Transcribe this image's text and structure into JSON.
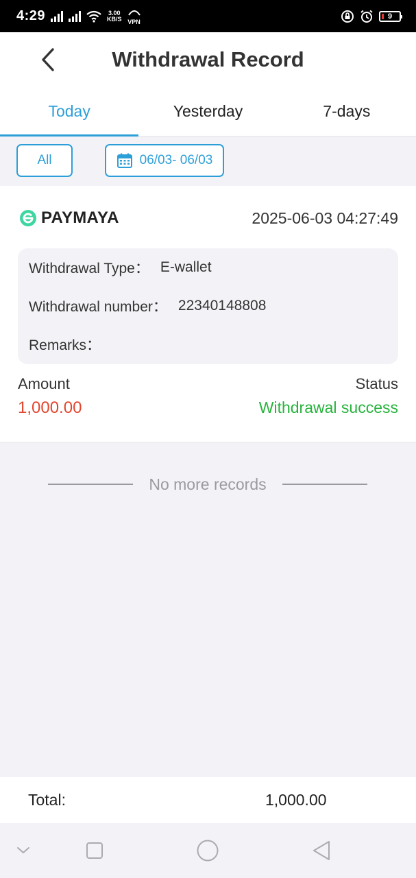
{
  "status_bar": {
    "time": "4:29",
    "net_speed_value": "3.00",
    "net_speed_unit": "KB/S",
    "vpn": "VPN",
    "battery": "9",
    "battery_color": "#e53935"
  },
  "header": {
    "title": "Withdrawal Record",
    "back_icon": "chevron-left-icon"
  },
  "tabs": [
    {
      "label": "Today",
      "active": true
    },
    {
      "label": "Yesterday",
      "active": false
    },
    {
      "label": "7-days",
      "active": false
    }
  ],
  "filters": {
    "all_label": "All",
    "date_range": "06/03- 06/03",
    "date_icon": "calendar-icon"
  },
  "record": {
    "brand": "PAYMAYA",
    "brand_icon": "paymaya-logo-icon",
    "datetime": "2025-06-03 04:27:49",
    "details": {
      "type_label": "Withdrawal Type：",
      "type_value": "E-wallet",
      "number_label": "Withdrawal number：",
      "number_value": "22340148808",
      "remarks_label": "Remarks："
    },
    "amount_label": "Amount",
    "amount_value": "1,000.00",
    "status_label": "Status",
    "status_value": "Withdrawal success"
  },
  "list_end_text": "No more records",
  "footer": {
    "total_label": "Total:",
    "total_value": "1,000.00"
  },
  "colors": {
    "accent": "#2d9fd8",
    "amount": "#e2462e",
    "success": "#25b33b",
    "brand_green": "#3ed6a0"
  },
  "nav_bar": {
    "icons": [
      "collapse-chevron-icon",
      "recents-square-icon",
      "home-circle-icon",
      "back-triangle-icon"
    ]
  }
}
